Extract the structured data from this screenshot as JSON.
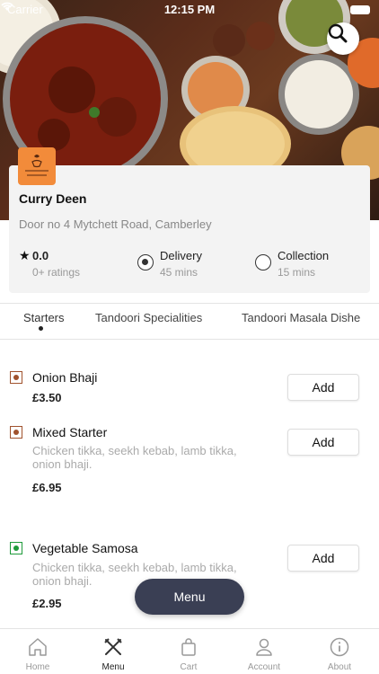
{
  "status_bar": {
    "carrier": "Carrier",
    "time": "12:15 PM"
  },
  "restaurant": {
    "name": "Curry Deen",
    "address": "Door no 4 Mytchett Road, Camberley",
    "rating": "0.0",
    "rating_count": "0+ ratings"
  },
  "order_options": {
    "delivery": {
      "label": "Delivery",
      "time": "45 mins",
      "selected": true
    },
    "collection": {
      "label": "Collection",
      "time": "15 mins",
      "selected": false
    }
  },
  "tabs": [
    {
      "label": "Starters"
    },
    {
      "label": "Tandoori Specialities"
    },
    {
      "label": "Tandoori Masala Dishe"
    }
  ],
  "menu_items": [
    {
      "name": "Onion Bhaji",
      "description": "",
      "price": "£3.50",
      "add_label": "Add",
      "veg": false
    },
    {
      "name": "Mixed Starter",
      "description": "Chicken tikka, seekh kebab, lamb tikka, onion bhaji.",
      "price": "£6.95",
      "add_label": "Add",
      "veg": false
    },
    {
      "name": "Vegetable Samosa",
      "description": "Chicken tikka, seekh kebab, lamb tikka, onion bhaji.",
      "price": "£2.95",
      "add_label": "Add",
      "veg": true
    }
  ],
  "menu_button": "Menu",
  "bottom_nav": [
    {
      "label": "Home",
      "icon": "home-icon"
    },
    {
      "label": "Menu",
      "icon": "fork-knife-icon"
    },
    {
      "label": "Cart",
      "icon": "bag-icon"
    },
    {
      "label": "Account",
      "icon": "person-icon"
    },
    {
      "label": "About",
      "icon": "info-icon"
    }
  ],
  "colors": {
    "accent": "#c8102e",
    "fab": "#3a3f54",
    "logo": "#f28b3a",
    "non_veg": "#a0522d",
    "veg": "#1e9a3a"
  }
}
